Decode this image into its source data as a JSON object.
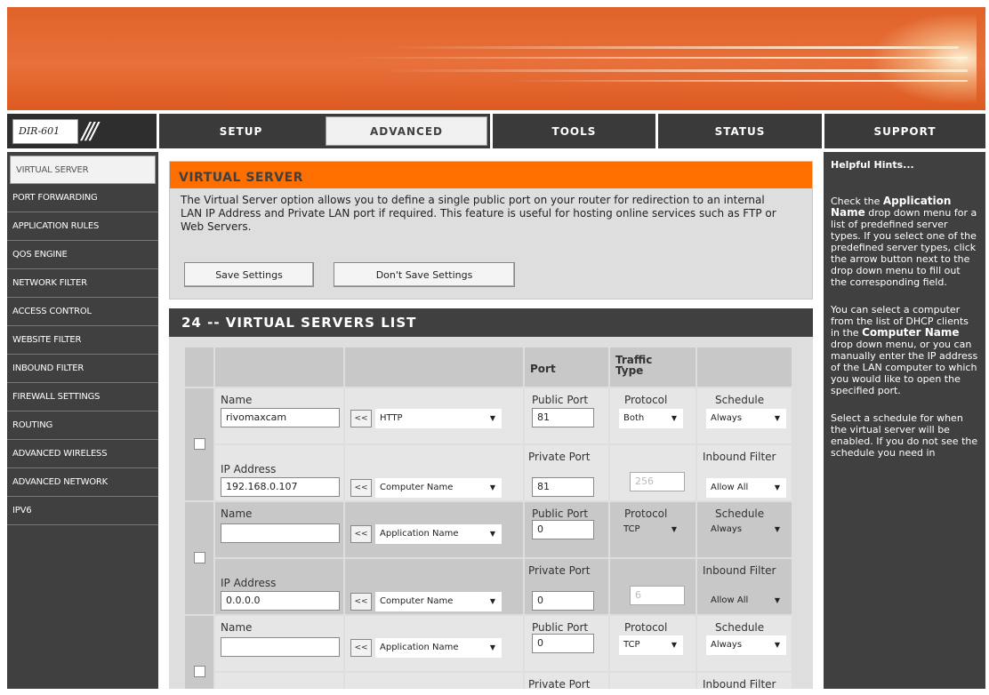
{
  "header": {
    "model": "DIR-601"
  },
  "tabs": [
    {
      "label": "SETUP",
      "active": false
    },
    {
      "label": "ADVANCED",
      "active": true
    },
    {
      "label": "TOOLS",
      "active": false
    },
    {
      "label": "STATUS",
      "active": false
    },
    {
      "label": "SUPPORT",
      "active": false
    }
  ],
  "sidebar": {
    "items": [
      {
        "label": "VIRTUAL SERVER",
        "active": true
      },
      {
        "label": "PORT FORWARDING"
      },
      {
        "label": "APPLICATION RULES"
      },
      {
        "label": "QOS ENGINE"
      },
      {
        "label": "NETWORK FILTER"
      },
      {
        "label": "ACCESS CONTROL"
      },
      {
        "label": "WEBSITE FILTER"
      },
      {
        "label": "INBOUND FILTER"
      },
      {
        "label": "FIREWALL SETTINGS"
      },
      {
        "label": "ROUTING"
      },
      {
        "label": "ADVANCED WIRELESS"
      },
      {
        "label": "ADVANCED NETWORK"
      },
      {
        "label": "IPV6"
      }
    ]
  },
  "virtual_server": {
    "title": "VIRTUAL SERVER",
    "description": "The Virtual Server option allows you to define a single public port on your router for redirection to an internal LAN IP Address and Private LAN port if required. This feature is useful for hosting online services such as FTP or Web Servers.",
    "save_label": "Save Settings",
    "dont_save_label": "Don't Save Settings"
  },
  "list": {
    "title": "24 -- VIRTUAL SERVERS LIST",
    "col_port": "Port",
    "col_traffic": "Traffic Type",
    "lbl_name": "Name",
    "lbl_ip": "IP Address",
    "lbl_public_port": "Public Port",
    "lbl_private_port": "Private Port",
    "lbl_protocol": "Protocol",
    "lbl_schedule": "Schedule",
    "lbl_inbound": "Inbound Filter",
    "arrow_label": "<<",
    "entries": [
      {
        "name": "rivomaxcam",
        "app": "HTTP",
        "public_port": "81",
        "protocol": "Both",
        "schedule": "Always",
        "ip": "192.168.0.107",
        "computer": "Computer Name",
        "private_port": "81",
        "proto_num": "256",
        "inbound": "Allow All"
      },
      {
        "name": "",
        "app": "Application Name",
        "public_port": "0",
        "protocol": "TCP",
        "schedule": "Always",
        "ip": "0.0.0.0",
        "computer": "Computer Name",
        "private_port": "0",
        "proto_num": "6",
        "inbound": "Allow All"
      },
      {
        "name": "",
        "app": "Application Name",
        "public_port": "0",
        "protocol": "TCP",
        "schedule": "Always"
      }
    ]
  },
  "hints": {
    "title": "Helpful Hints...",
    "p1_pre": "Check the ",
    "p1_bold": "Application Name",
    "p1_post": " drop down menu for a list of predefined server types. If you select one of the predefined server types, click the arrow button next to the drop down menu to fill out the corresponding field.",
    "p2_pre": "You can select a computer from the list of DHCP clients in the ",
    "p2_bold": "Computer Name",
    "p2_post": " drop down menu, or you can manually enter the IP address of the LAN computer to which you would like to open the specified port.",
    "p3": "Select a schedule for when the virtual server will be enabled. If you do not see the schedule you need in"
  }
}
